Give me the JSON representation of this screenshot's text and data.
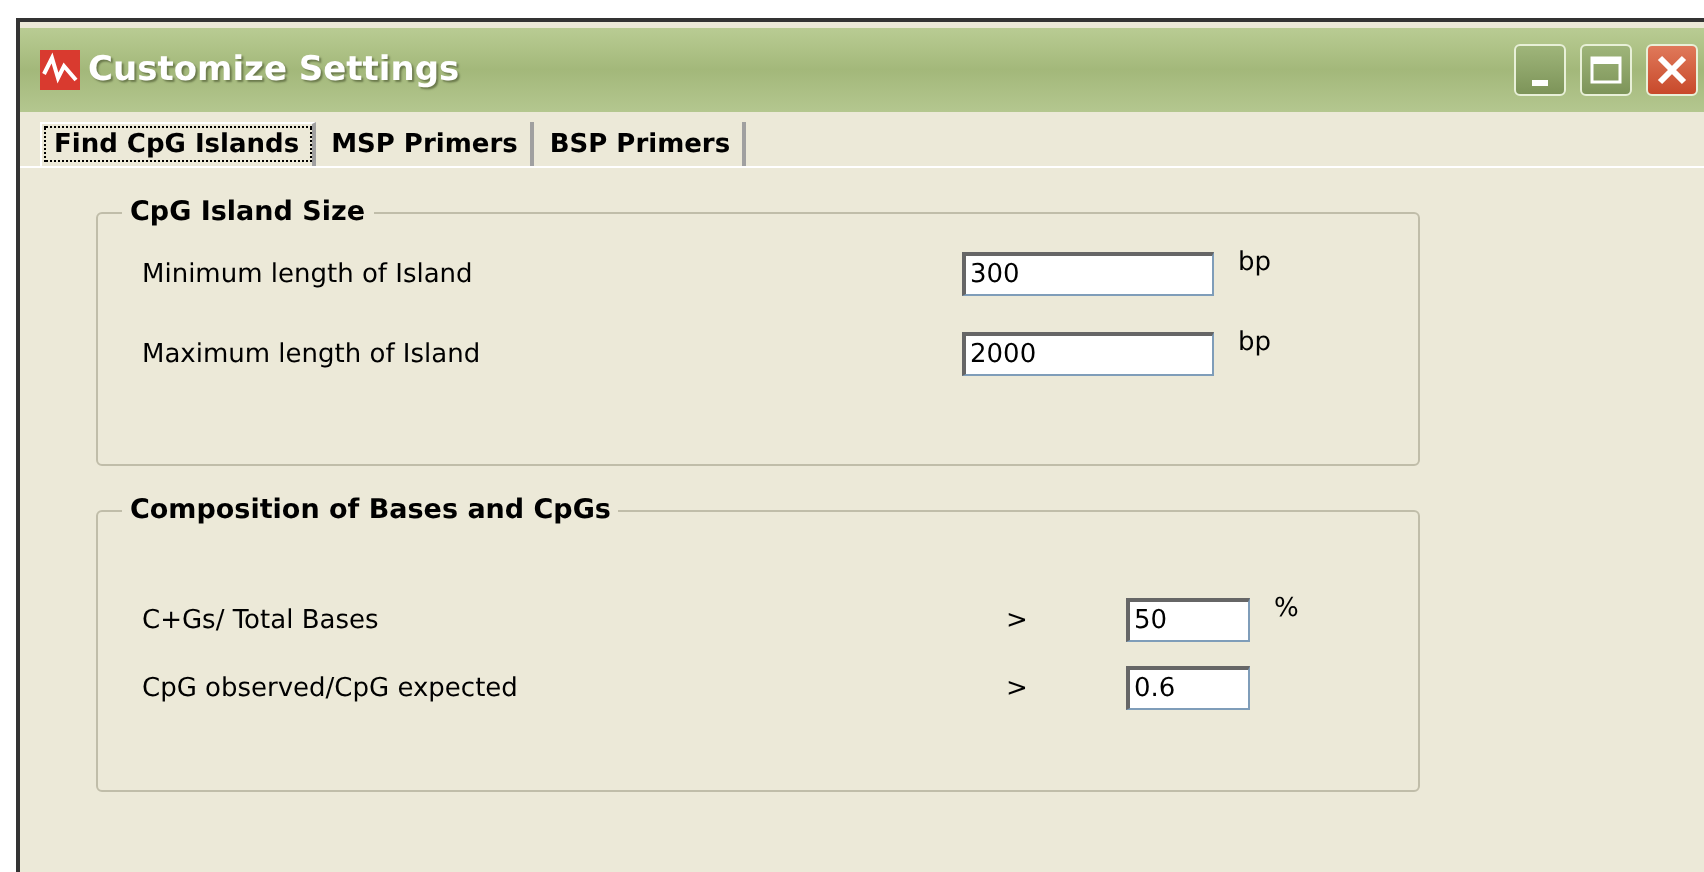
{
  "window": {
    "title": "Customize Settings"
  },
  "tabs": [
    {
      "label": "Find CpG Islands",
      "selected": true
    },
    {
      "label": "MSP Primers",
      "selected": false
    },
    {
      "label": "BSP Primers",
      "selected": false
    }
  ],
  "groups": [
    {
      "title": "CpG Island Size",
      "rows": [
        {
          "label": "Minimum length of Island",
          "value": "300",
          "unit": "bp"
        },
        {
          "label": "Maximum length of Island",
          "value": "2000",
          "unit": "bp"
        }
      ]
    },
    {
      "title": "Composition of Bases and CpGs",
      "rows": [
        {
          "label": "C+Gs/ Total Bases",
          "comparator": ">",
          "value": "50",
          "unit": "%"
        },
        {
          "label": "CpG observed/CpG expected",
          "comparator": ">",
          "value": "0.6"
        }
      ]
    }
  ]
}
